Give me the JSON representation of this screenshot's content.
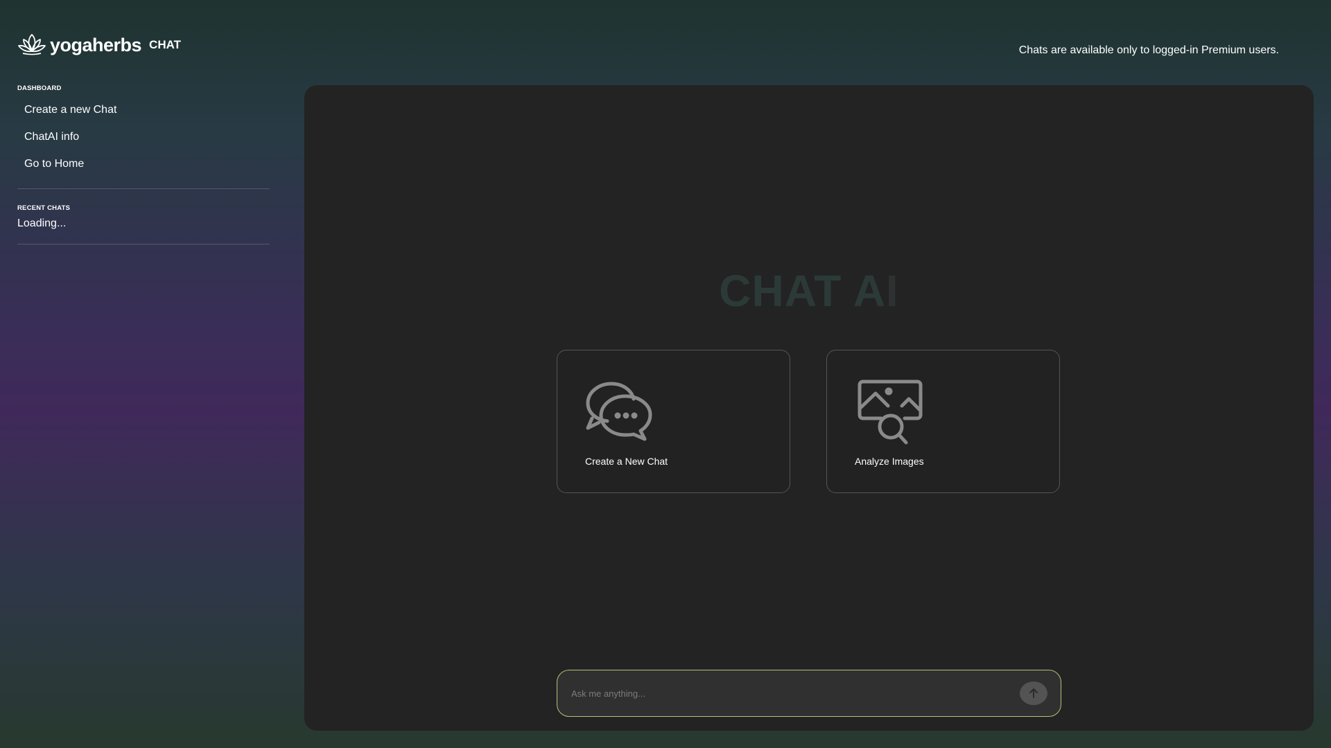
{
  "brand": {
    "name": "yogaherbs",
    "tag": "CHAT",
    "logo_icon": "lotus-icon"
  },
  "header": {
    "premium_note": "Chats are available only to logged-in Premium users."
  },
  "sidebar": {
    "dashboard_label": "DASHBOARD",
    "items": [
      {
        "label": "Create a new Chat"
      },
      {
        "label": "ChatAI info"
      },
      {
        "label": "Go to Home"
      }
    ],
    "recent_label": "RECENT CHATS",
    "recent_status": "Loading..."
  },
  "main": {
    "title_main": "CHAT A",
    "title_faded": "I",
    "cards": [
      {
        "label": "Create a New Chat",
        "icon": "chat-bubbles-icon"
      },
      {
        "label": "Analyze Images",
        "icon": "image-search-icon"
      }
    ],
    "input": {
      "placeholder": "Ask me anything...",
      "value": "",
      "send_icon": "arrow-up-icon"
    }
  },
  "colors": {
    "panel_bg": "#232323",
    "input_border": "#b8c07a",
    "icon_gray": "#8a8a8a"
  }
}
